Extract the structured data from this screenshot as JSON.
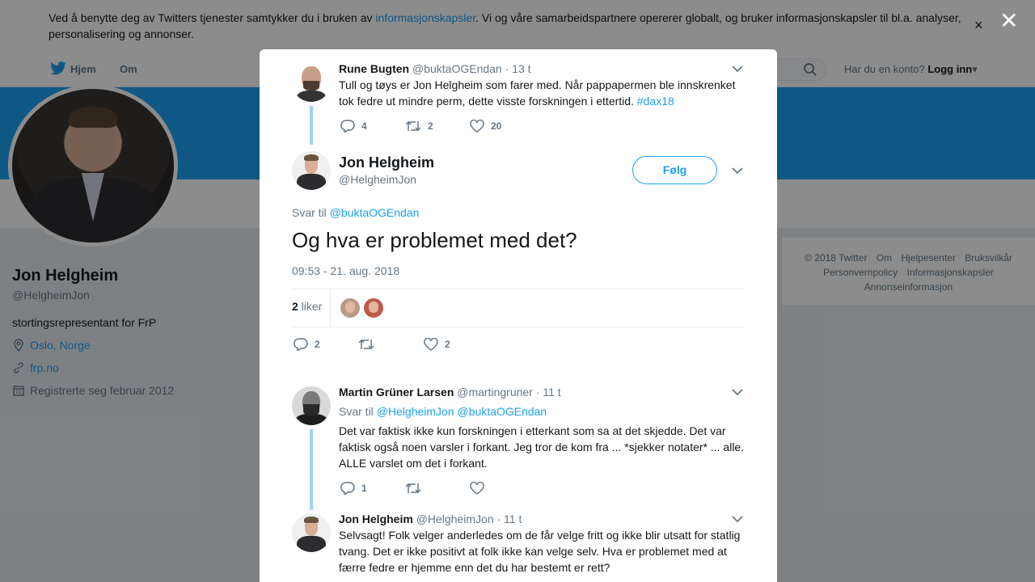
{
  "cookie": {
    "text_before": "Ved å benytte deg av Twitters tjenester samtykker du i bruken av ",
    "link": "informasjonskapsler",
    "text_after": ". Vi og våre samarbeidspartnere opererer globalt, og bruker informasjonskapsler til bl.a. analyser, personalisering og annonser.",
    "close": "×"
  },
  "nav": {
    "home": "Hjem",
    "about": "Om",
    "account_q": "Har du en konto?",
    "login": "Logg inn"
  },
  "profile": {
    "name": "Jon Helgheim",
    "handle": "@HelgheimJon",
    "bio": "stortingsrepresentant for FrP",
    "location": "Oslo, Norge",
    "website": "frp.no",
    "joined": "Registrerte seg februar 2012"
  },
  "footer": {
    "items": [
      "© 2018 Twitter",
      "Om",
      "Hjelpesenter",
      "Bruksvilkår",
      "Personvernpolicy",
      "Informasjonskapsler",
      "Annonseinformasjon"
    ]
  },
  "modal": {
    "close": "✕",
    "parent": {
      "name": "Rune Bugten",
      "handle": "@buktaOGEndan",
      "time": "· 13 t",
      "text": "Tull og tøys er Jon Helgheim som farer med. Når pappapermen ble innskrenket tok fedre ut mindre perm, dette visste forskningen i ettertid. ",
      "hashtag": "#dax18",
      "replies": "4",
      "retweets": "2",
      "likes": "20"
    },
    "main": {
      "name": "Jon Helgheim",
      "handle": "@HelgheimJon",
      "follow": "Følg",
      "reply_label": "Svar til",
      "reply_to": "@buktaOGEndan",
      "text": "Og hva er problemet med det?",
      "timestamp": "09:53 - 21. aug. 2018",
      "likes_count": "2",
      "likes_word": "liker",
      "replies": "2",
      "retweets": "",
      "likes": "2"
    },
    "reply1": {
      "name": "Martin Grüner Larsen",
      "handle": "@martingruner",
      "time": "· 11 t",
      "reply_label": "Svar til",
      "reply_to": "@HelgheimJon @buktaOGEndan",
      "text": "Det var faktisk ikke kun forskningen i etterkant som sa at det skjedde. Det var faktisk også noen varsler i forkant. Jeg tror de kom fra ... *sjekker notater* ... alle. ALLE varslet om det i forkant.",
      "replies": "1",
      "retweets": "",
      "likes": ""
    },
    "reply2": {
      "name": "Jon Helgheim",
      "handle": "@HelgheimJon",
      "time": "· 11 t",
      "text": "Selvsagt! Folk velger anderledes om de får velge fritt og ikke blir utsatt for statlig tvang. Det er ikke positivt at folk ikke kan velge selv. Hva er problemet med at færre fedre er hjemme enn det du har bestemt er rett?"
    }
  },
  "colors": {
    "accent": "#1da1f2",
    "thread": "#9ed3f5",
    "overlay": "rgba(0,0,0,0.45)"
  }
}
